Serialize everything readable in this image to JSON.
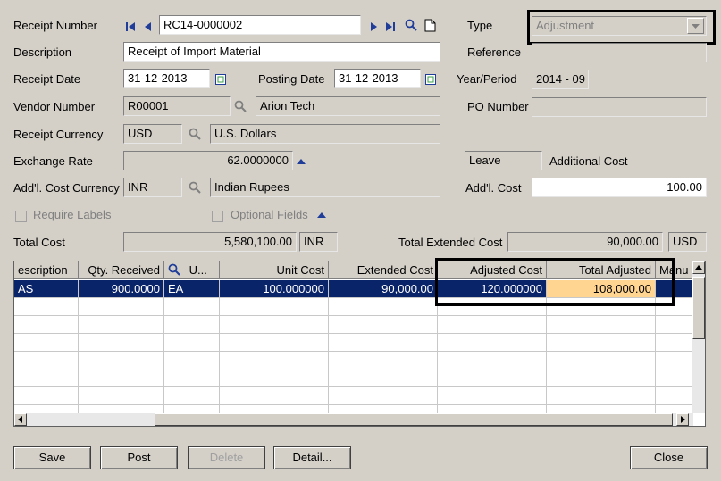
{
  "form": {
    "receipt_number_label": "Receipt Number",
    "receipt_number": "RC14-0000002",
    "type_label": "Type",
    "type_value": "Adjustment",
    "description_label": "Description",
    "description": "Receipt of Import Material",
    "reference_label": "Reference",
    "reference": "",
    "receipt_date_label": "Receipt Date",
    "receipt_date": "31-12-2013",
    "posting_date_label": "Posting Date",
    "posting_date": "31-12-2013",
    "year_period_label": "Year/Period",
    "year_period": "2014 - 09",
    "vendor_number_label": "Vendor Number",
    "vendor_number": "R00001",
    "vendor_name": "Arion Tech",
    "po_number_label": "PO Number",
    "po_number": "",
    "receipt_currency_label": "Receipt Currency",
    "receipt_currency": "USD",
    "receipt_currency_name": "U.S. Dollars",
    "exchange_rate_label": "Exchange Rate",
    "exchange_rate": "62.0000000",
    "leave_value": "Leave",
    "additional_cost_label": "Additional Cost",
    "addl_cost_currency_label": "Add'l. Cost Currency",
    "addl_cost_currency": "INR",
    "addl_cost_currency_name": "Indian Rupees",
    "addl_cost_label": "Add'l. Cost",
    "addl_cost": "100.00",
    "require_labels_label": "Require Labels",
    "optional_fields_label": "Optional Fields",
    "total_cost_label": "Total Cost",
    "total_cost": "5,580,100.00",
    "total_cost_currency": "INR",
    "total_extended_cost_label": "Total Extended Cost",
    "total_extended_cost": "90,000.00",
    "total_extended_currency": "USD"
  },
  "grid": {
    "headers": [
      "escription",
      "Qty. Received",
      "U...",
      "Unit Cost",
      "Extended Cost",
      "Adjusted Cost",
      "Total Adjusted",
      "Manu"
    ],
    "rows": [
      [
        "AS",
        "900.0000",
        "EA",
        "100.000000",
        "90,000.00",
        "120.000000",
        "108,000.00",
        ""
      ]
    ]
  },
  "buttons": {
    "save": "Save",
    "post": "Post",
    "delete": "Delete",
    "detail": "Detail...",
    "close": "Close"
  },
  "colors": {
    "window_bg": "#d4d0c8",
    "selection": "#0a246a",
    "highlight_cell": "#ffd591",
    "nav_icon": "#1f3d99"
  }
}
